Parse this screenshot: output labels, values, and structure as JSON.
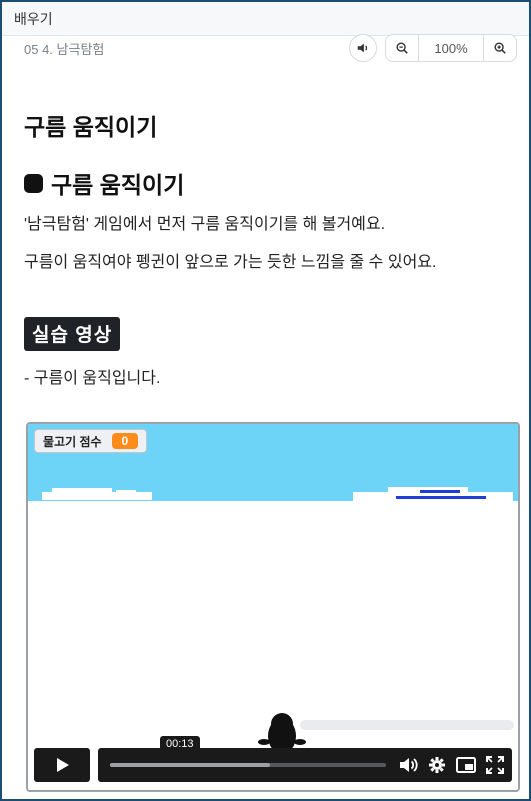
{
  "topbar": {
    "title": "배우기"
  },
  "breadcrumb": "05 4. 남극탐험",
  "toolbar": {
    "zoom_value": "100%",
    "icons": [
      "speaker-icon",
      "zoom-out-icon",
      "zoom-in-icon"
    ]
  },
  "page": {
    "title": "구름 움직이기"
  },
  "section": {
    "title": "구름 움직이기",
    "paragraphs": [
      "'남극탐험' 게임에서 먼저 구름 움직이기를 해 볼거예요.",
      "구름이 움직여야 펭귄이 앞으로 가는 듯한 느낌을 줄 수 있어요."
    ]
  },
  "practice": {
    "tag": "실습 영상",
    "bullet": "- 구름이 움직입니다."
  },
  "video": {
    "score_label": "물고기 점수",
    "score_value": "0",
    "time": "00:13",
    "progress": 0.58,
    "colors": {
      "sky": "#6dd3f7",
      "score_badge": "#ff8c1a",
      "controls_bg": "#1a1a1a"
    },
    "control_icons": [
      "play-icon",
      "volume-icon",
      "settings-gear-icon",
      "picture-in-picture-icon",
      "fullscreen-icon"
    ]
  }
}
